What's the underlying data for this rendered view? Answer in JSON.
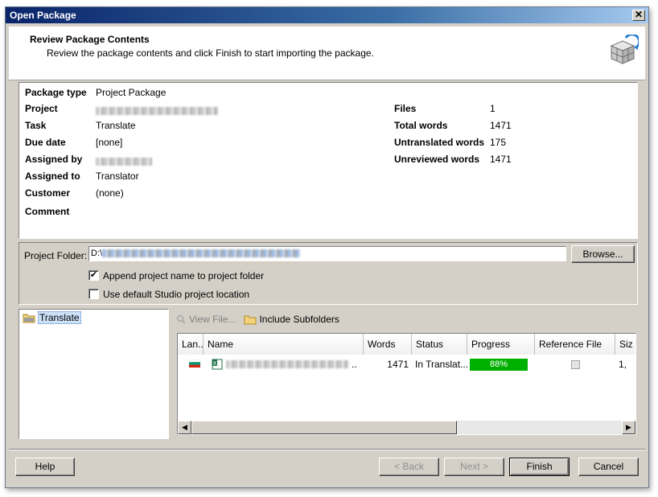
{
  "window": {
    "title": "Open Package",
    "close_glyph": "✕"
  },
  "header": {
    "title": "Review Package Contents",
    "subtitle": "Review the package contents and click Finish to start importing the package.",
    "icon": "package-box-icon"
  },
  "info": {
    "package_type_label": "Package type",
    "package_type_value": "Project Package",
    "project_label": "Project",
    "task_label": "Task",
    "task_value": "Translate",
    "due_date_label": "Due date",
    "due_date_value": "[none]",
    "assigned_by_label": "Assigned by",
    "assigned_to_label": "Assigned to",
    "assigned_to_value": "Translator",
    "customer_label": "Customer",
    "customer_value": "(none)",
    "comment_label": "Comment",
    "files_label": "Files",
    "files_value": "1",
    "total_words_label": "Total words",
    "total_words_value": "1471",
    "untranslated_label": "Untranslated words",
    "untranslated_value": "175",
    "unreviewed_label": "Unreviewed words",
    "unreviewed_value": "1471"
  },
  "folder": {
    "label": "Project Folder:",
    "value_prefix": "D:\\",
    "browse_label": "Browse...",
    "append_label": "Append project name to project folder",
    "append_checked": true,
    "default_location_label": "Use default Studio project location",
    "default_location_checked": false
  },
  "tree": {
    "item_label": "Translate"
  },
  "files": {
    "view_file_label": "View File...",
    "include_subfolders_label": "Include Subfolders",
    "columns": [
      "Lan...",
      "Name",
      "Words",
      "Status",
      "Progress",
      "Reference File",
      "Siz"
    ],
    "rows": [
      {
        "words": "1471",
        "status": "In Translat...",
        "progress_text": "88%",
        "progress": 88,
        "size": "1,"
      }
    ]
  },
  "footer": {
    "help_label": "Help",
    "back_label": "< Back",
    "next_label": "Next >",
    "finish_label": "Finish",
    "cancel_label": "Cancel"
  },
  "colors": {
    "title_bar": "#0a246a",
    "progress_fill": "#00b000",
    "selection": "#cce0f7"
  }
}
